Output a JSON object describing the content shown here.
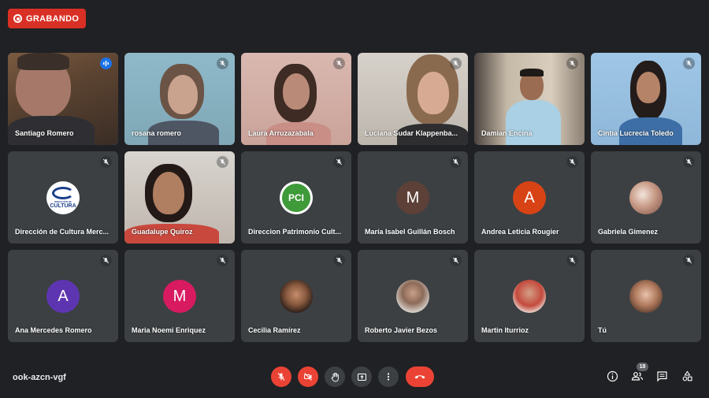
{
  "recording": {
    "label": "GRABANDO"
  },
  "meeting": {
    "code": "ook-azcn-vgf",
    "participant_count": "18"
  },
  "participants": [
    {
      "name": "Santiago Romero",
      "mic": "speaking",
      "type": "video"
    },
    {
      "name": "rosana romero",
      "mic": "muted",
      "type": "video"
    },
    {
      "name": "Laura Arruzazabala",
      "mic": "muted",
      "type": "video"
    },
    {
      "name": "Luciana Sudar Klappenba...",
      "mic": "muted",
      "type": "video"
    },
    {
      "name": "Damian Encina",
      "mic": "muted",
      "type": "video"
    },
    {
      "name": "Cintia Lucrecia Toledo",
      "mic": "muted",
      "type": "video"
    },
    {
      "name": "Dirección de Cultura Merc...",
      "mic": "muted",
      "type": "logo"
    },
    {
      "name": "Guadalupe Quiroz",
      "mic": "muted",
      "type": "video"
    },
    {
      "name": "Direccion Patrimonio Cult...",
      "mic": "muted",
      "type": "logo"
    },
    {
      "name": "María Isabel Guillán Bosch",
      "mic": "muted",
      "type": "initial",
      "initial": "M"
    },
    {
      "name": "Andrea Leticia Rougier",
      "mic": "muted",
      "type": "initial",
      "initial": "A"
    },
    {
      "name": "Gabriela Gimenez",
      "mic": "muted",
      "type": "photo"
    },
    {
      "name": "Ana Mercedes Romero",
      "mic": "muted",
      "type": "initial",
      "initial": "A"
    },
    {
      "name": "Maria Noemi Enriquez",
      "mic": "muted",
      "type": "initial",
      "initial": "M"
    },
    {
      "name": "Cecilia Ramírez",
      "mic": "muted",
      "type": "photo"
    },
    {
      "name": "Roberto Javier Bezos",
      "mic": "muted",
      "type": "photo"
    },
    {
      "name": "Martin Iturrioz",
      "mic": "muted",
      "type": "photo"
    },
    {
      "name": "Tú",
      "mic": "muted",
      "type": "photo"
    }
  ],
  "logos": {
    "cultura": {
      "line1": "DIRECCIÓN DE",
      "line2": "CULTURA"
    },
    "pci": {
      "text": "PCI"
    }
  },
  "colors": {
    "background": "#202124",
    "tile": "#3c4043",
    "recording": "#d93025",
    "danger": "#ea4335",
    "active_speaker": "#8ab4f8",
    "avatar_brown": "#5d4037",
    "avatar_red": "#d84315",
    "avatar_purple": "#5e35b1",
    "avatar_pink": "#d81b60"
  },
  "controls": [
    "microphone-muted",
    "camera-off",
    "raise-hand",
    "present-screen",
    "more-options",
    "leave-call"
  ],
  "right_controls": [
    "meeting-details",
    "participants",
    "chat",
    "activities"
  ]
}
